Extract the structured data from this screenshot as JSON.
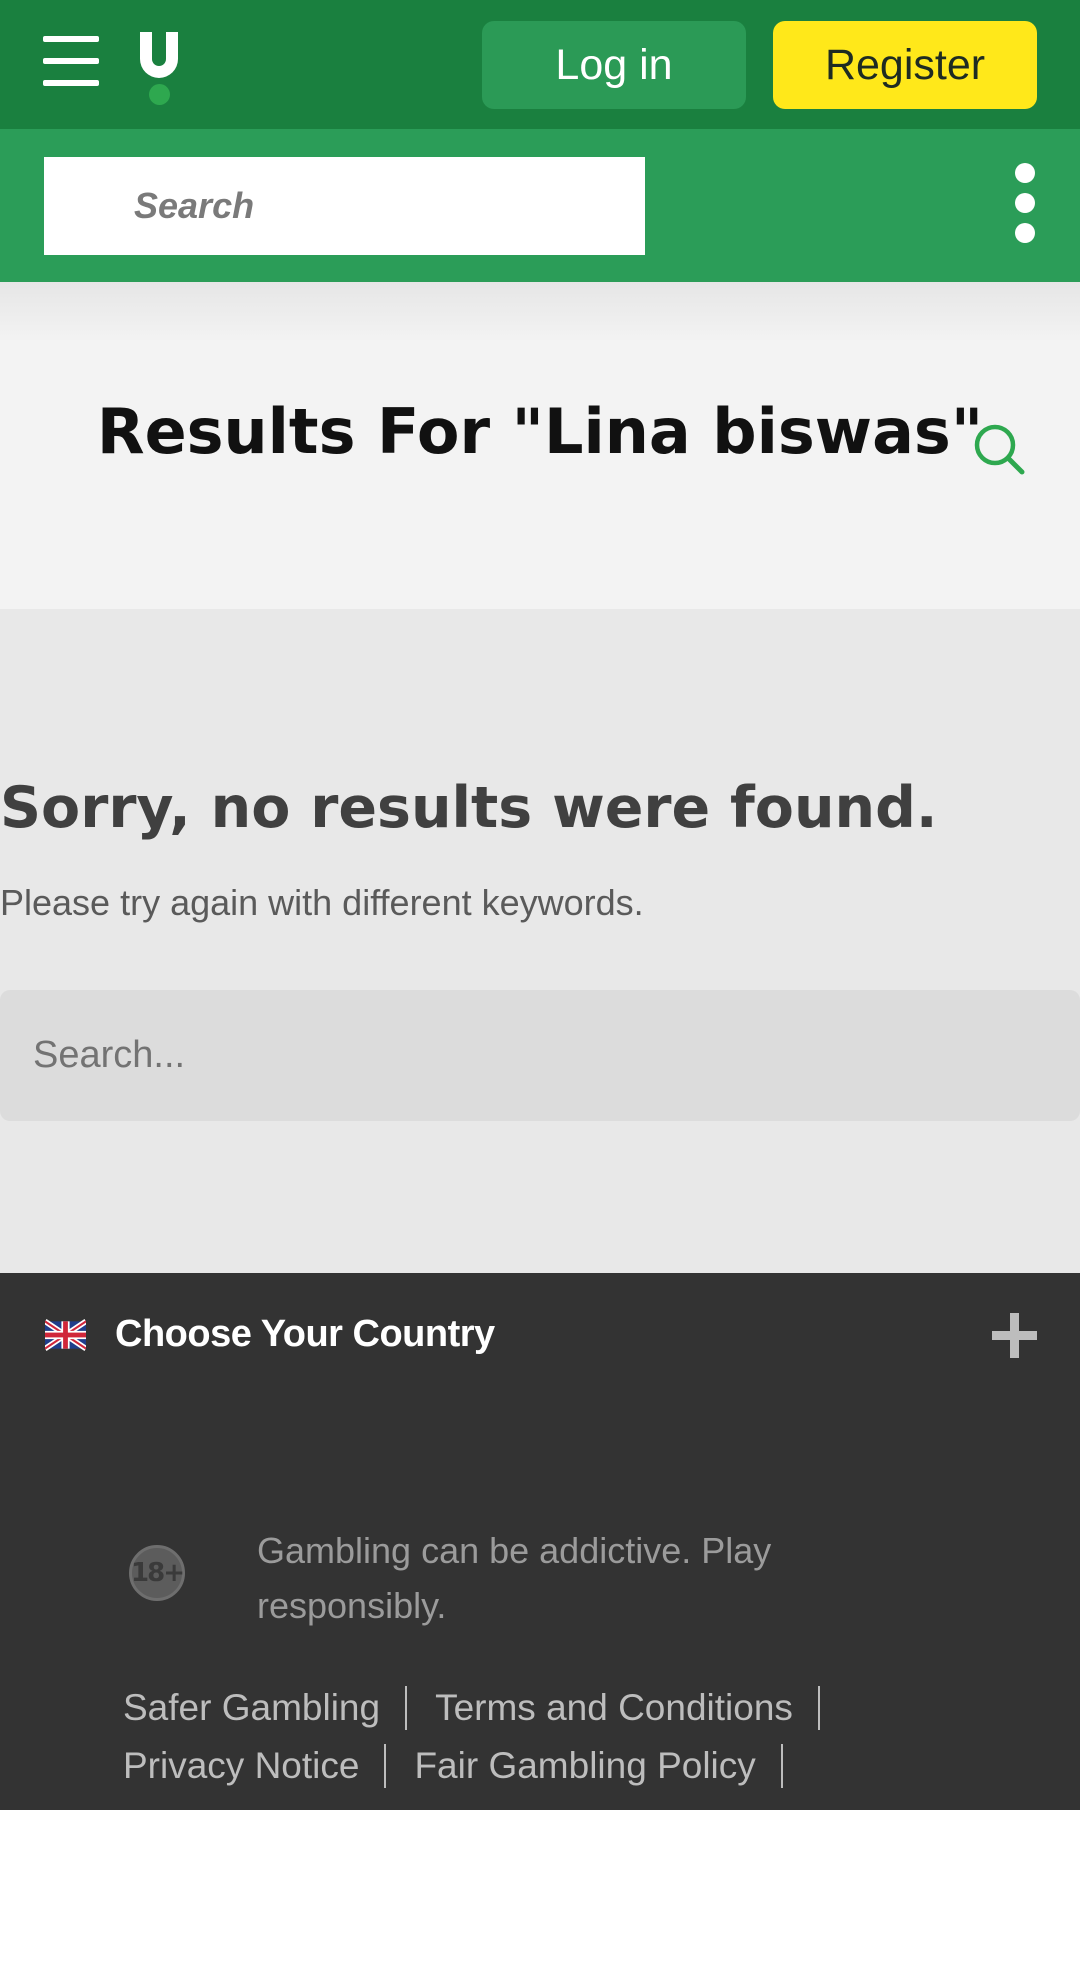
{
  "header": {
    "login_label": "Log in",
    "register_label": "Register",
    "menu_icon": "hamburger-menu-icon",
    "logo": "unibet-u-logo"
  },
  "top_search": {
    "placeholder": "Search",
    "more_icon": "kebab-menu-icon"
  },
  "results": {
    "title": "Results For \"Lina biswas\""
  },
  "no_results": {
    "heading": "Sorry, no results were found.",
    "subtext": "Please try again with different keywords.",
    "search_placeholder": "Search...",
    "search_icon": "search-icon"
  },
  "footer": {
    "country_label": "Choose Your Country",
    "flag_icon": "uk-flag-icon",
    "expand_icon": "plus-icon",
    "age_badge": "18+",
    "gambling_note": "Gambling can be addictive. Play responsibly.",
    "links": [
      [
        "Safer Gambling",
        "Terms and Conditions"
      ],
      [
        "Privacy Notice",
        "Fair Gambling Policy"
      ]
    ]
  },
  "colors": {
    "header_dark_green": "#1a803f",
    "header_light_green": "#2b9d58",
    "register_yellow": "#ffe81a",
    "footer_dark": "#333333",
    "search_icon_green": "#2ea84f"
  }
}
